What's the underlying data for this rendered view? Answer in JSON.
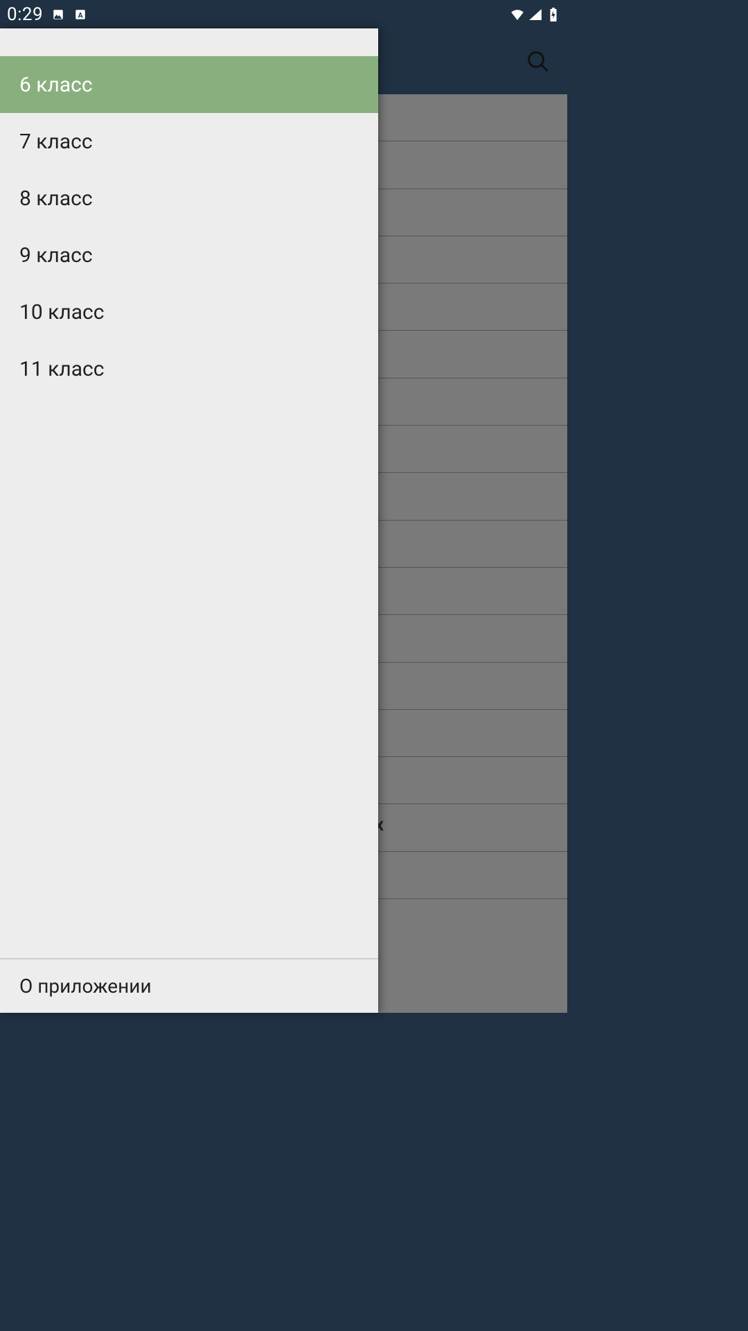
{
  "status": {
    "time": "0:29",
    "icons_left": [
      "image-icon",
      "text-a-icon"
    ],
    "icons_right": [
      "wifi-icon",
      "cell-signal-icon",
      "battery-charging-icon"
    ]
  },
  "appbar": {
    "search_icon": "search-icon"
  },
  "drawer": {
    "items": [
      {
        "label": "6 класс",
        "active": true
      },
      {
        "label": "7 класс",
        "active": false
      },
      {
        "label": "8 класс",
        "active": false
      },
      {
        "label": "9 класс",
        "active": false
      },
      {
        "label": "10 класс",
        "active": false
      },
      {
        "label": "11 класс",
        "active": false
      }
    ],
    "footer_label": "О приложении"
  },
  "background": {
    "row_count": 17,
    "visible_letter": "x"
  },
  "colors": {
    "status_bg": "#1f3142",
    "drawer_bg": "#ededed",
    "active_bg": "#8aaf7e",
    "dim_bg": "#7a7a7a"
  }
}
